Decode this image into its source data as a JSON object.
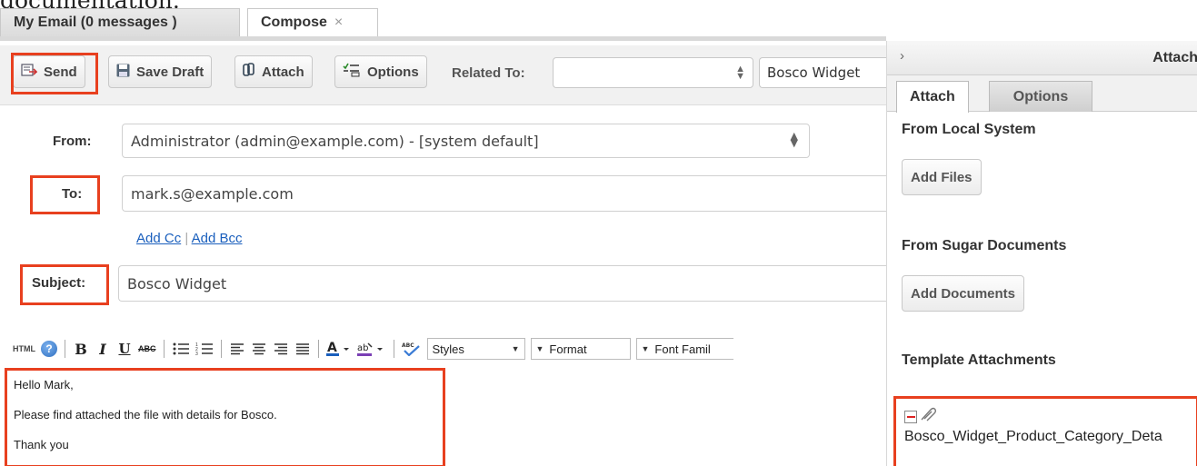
{
  "doc_fragment": "documentation.",
  "tabs": [
    {
      "label": "My Email (0 messages )"
    },
    {
      "label": "Compose",
      "close": "×"
    }
  ],
  "toolbar": {
    "send": "Send",
    "save_draft": "Save Draft",
    "attach": "Attach",
    "options": "Options",
    "related_to_label": "Related To:",
    "related_value": "Bosco Widget"
  },
  "form": {
    "from_label": "From:",
    "from_value": "Administrator (admin@example.com) - [system default]",
    "to_label": "To:",
    "to_value": "mark.s@example.com",
    "add_cc": "Add Cc",
    "sep": "|",
    "add_bcc": "Add Bcc",
    "subject_label": "Subject:",
    "subject_value": "Bosco Widget"
  },
  "editor": {
    "html_label": "HTML",
    "bold": "B",
    "italic": "I",
    "underline": "U",
    "strike": "ABC",
    "spell": "ABC",
    "styles": "Styles",
    "format": "Format",
    "font_family": "Font Famil"
  },
  "body_lines": [
    "Hello Mark,",
    "Please find attached the file with details for Bosco.",
    "Thank you"
  ],
  "panel": {
    "header": "Attach",
    "chevron": "›",
    "tabs": [
      "Attach",
      "Options"
    ],
    "local_heading": "From Local System",
    "add_files": "Add Files",
    "sugar_heading": "From Sugar Documents",
    "add_documents": "Add Documents",
    "template_heading": "Template Attachments",
    "attachment_name": "Bosco_Widget_Product_Category_Deta"
  },
  "colors": {
    "highlight": "#e8401f",
    "link": "#1a5fbd"
  }
}
